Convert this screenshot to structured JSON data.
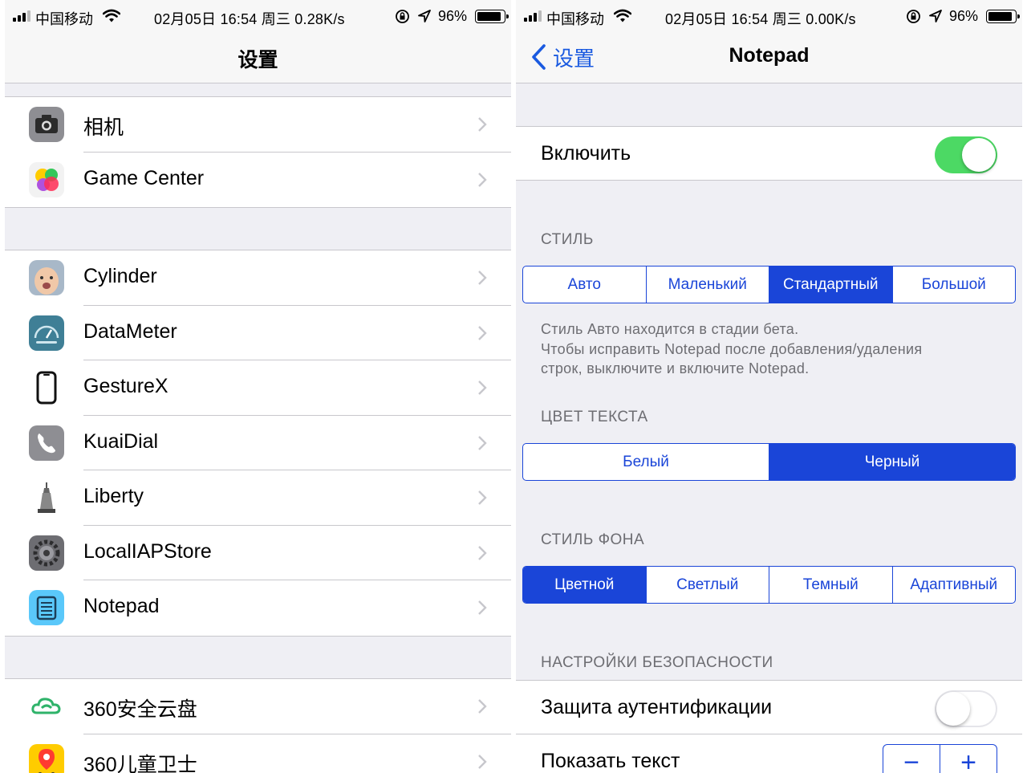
{
  "colors": {
    "accent": "#1a45d8",
    "switch_on": "#4cd964",
    "group_bg": "#efeff4",
    "separator": "#c8c7cc"
  },
  "left": {
    "status": {
      "carrier": "中国移动",
      "time": "02月05日 16:54 周三  0.28K/s",
      "battery": "96%"
    },
    "nav_title": "设置",
    "groups": [
      {
        "items": [
          {
            "label": "相机",
            "icon": "camera-icon"
          },
          {
            "label": "Game Center",
            "icon": "game-center-icon"
          }
        ]
      },
      {
        "items": [
          {
            "label": "Cylinder",
            "icon": "cylinder-icon"
          },
          {
            "label": "DataMeter",
            "icon": "datameter-icon"
          },
          {
            "label": "GestureX",
            "icon": "gesturex-icon"
          },
          {
            "label": "KuaiDial",
            "icon": "kuaidial-icon"
          },
          {
            "label": "Liberty",
            "icon": "liberty-icon"
          },
          {
            "label": "LocalIAPStore",
            "icon": "localiapstore-icon"
          },
          {
            "label": "Notepad",
            "icon": "notepad-icon"
          }
        ]
      },
      {
        "items": [
          {
            "label": "360安全云盘",
            "icon": "cloud-drive-icon"
          },
          {
            "label": "360儿童卫士",
            "icon": "child-guard-icon"
          }
        ]
      }
    ]
  },
  "right": {
    "status": {
      "carrier": "中国移动",
      "time": "02月05日 16:54 周三  0.00K/s",
      "battery": "96%"
    },
    "nav_back": "设置",
    "nav_title": "Notepad",
    "enable": {
      "label": "Включить",
      "on": true
    },
    "style": {
      "header": "СТИЛЬ",
      "options": [
        "Авто",
        "Маленький",
        "Стандартный",
        "Большой"
      ],
      "selected": "Стандартный",
      "footnote": [
        "Стиль Авто находится в стадии бета.",
        "Чтобы исправить Notepad после добавления/удаления",
        "строк, выключите и включите Notepad."
      ]
    },
    "text_color": {
      "header": "ЦВЕТ ТЕКСТА",
      "options": [
        "Белый",
        "Черный"
      ],
      "selected": "Черный"
    },
    "bg_style": {
      "header": "СТИЛЬ ФОНА",
      "options": [
        "Цветной",
        "Светлый",
        "Темный",
        "Адаптивный"
      ],
      "selected": "Цветной"
    },
    "security": {
      "header": "НАСТРОЙКИ БЕЗОПАСНОСТИ",
      "auth_label": "Защита аутентификации",
      "auth_on": false,
      "show_text_label": "Показать текст",
      "stepper_minus": "−",
      "stepper_plus": "+"
    }
  }
}
